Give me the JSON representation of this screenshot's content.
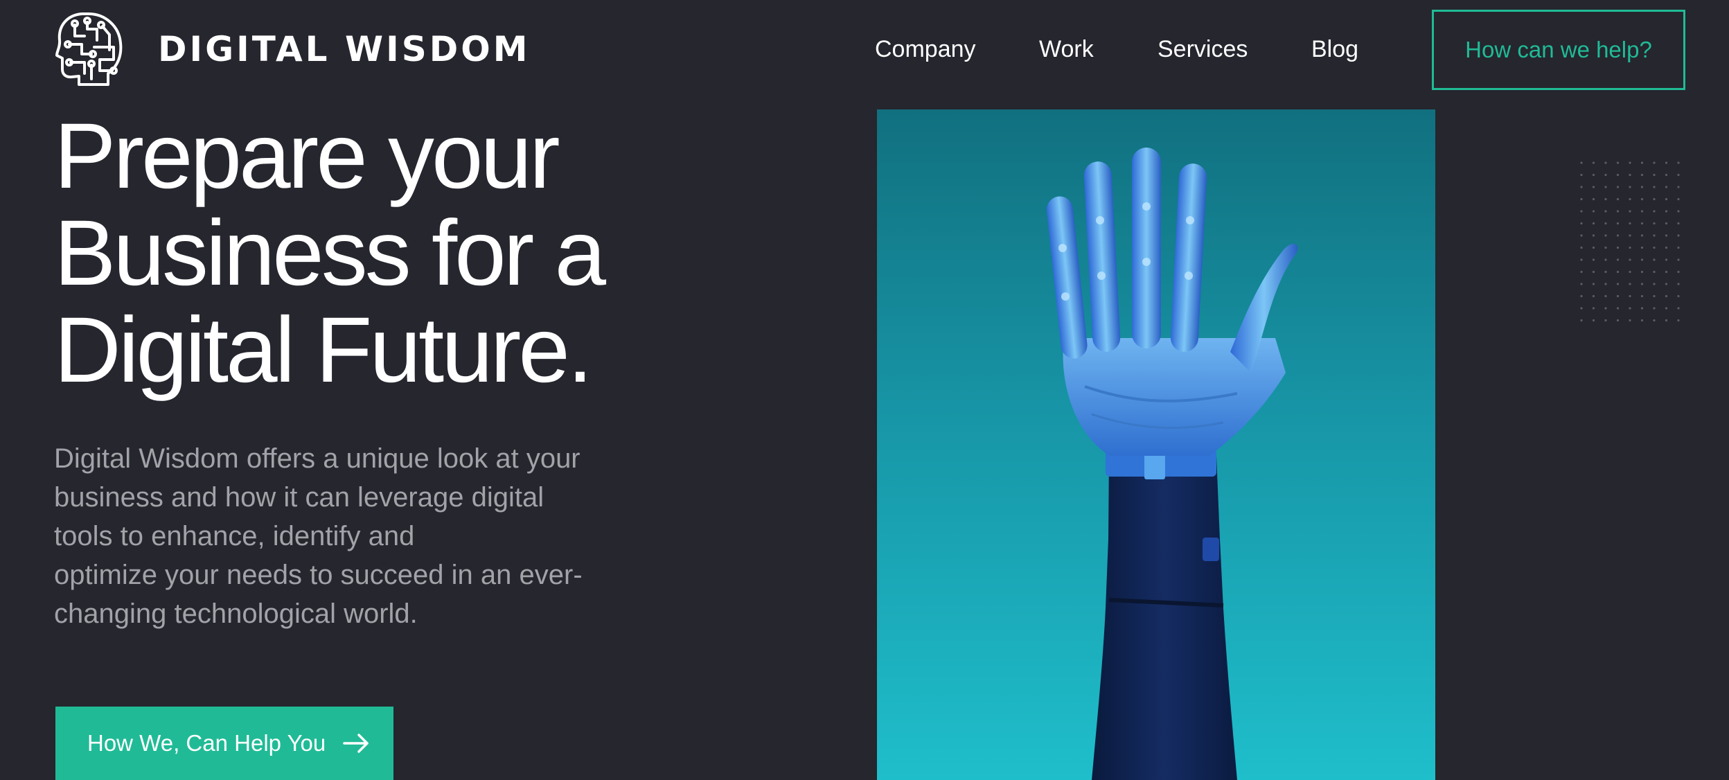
{
  "header": {
    "brand": "DIGITAL WISDOM",
    "logo_icon": "circuit-head-logo-icon",
    "nav": [
      {
        "label": "Company"
      },
      {
        "label": "Work"
      },
      {
        "label": "Services"
      },
      {
        "label": "Blog"
      }
    ],
    "cta_label": "How can we help?"
  },
  "hero": {
    "headline_lines": [
      "Prepare your",
      "Business for a",
      "Digital Future."
    ],
    "intro_lines": [
      "Digital Wisdom offers a unique look at your",
      "business and how it can leverage digital",
      "tools to enhance, identify and",
      "optimize your needs to succeed in an ever-",
      "changing technological world."
    ],
    "button_label": "How We, Can Help You",
    "button_icon": "arrow-right-icon",
    "image_subject": "robotic-hand-image"
  },
  "colors": {
    "background": "#25262e",
    "accent": "#20bb96",
    "muted_text": "#a2a3a8",
    "image_top": "#11707f",
    "image_bottom": "#1fbecb"
  }
}
